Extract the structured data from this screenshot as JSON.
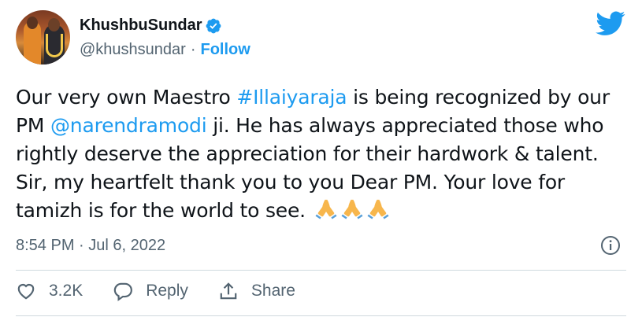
{
  "author": {
    "display_name": "KhushbuSundar",
    "handle": "@khushsundar",
    "separator": "·",
    "follow_label": "Follow"
  },
  "tweet": {
    "segments": [
      {
        "text": "Our very own Maestro ",
        "type": "text"
      },
      {
        "text": "#Illaiyaraja",
        "type": "hashtag"
      },
      {
        "text": " is being recognized by our PM ",
        "type": "text"
      },
      {
        "text": "@narendramodi",
        "type": "mention"
      },
      {
        "text": " ji. He has always appreciated those who rightly deserve the appreciation for their hardwork & talent. Sir, my heartfelt thank you to you Dear PM. Your love for tamizh is for the world to see. ",
        "type": "text"
      }
    ],
    "emoji_icons": [
      "folded-hands-icon",
      "folded-hands-icon",
      "folded-hands-icon"
    ],
    "timestamp": "8:54 PM · Jul 6, 2022"
  },
  "actions": {
    "like_count": "3.2K",
    "reply_label": "Reply",
    "share_label": "Share"
  },
  "colors": {
    "accent": "#1d9bf0",
    "text": "#0f1419",
    "secondary": "#536471",
    "divider": "#cfd9de"
  }
}
